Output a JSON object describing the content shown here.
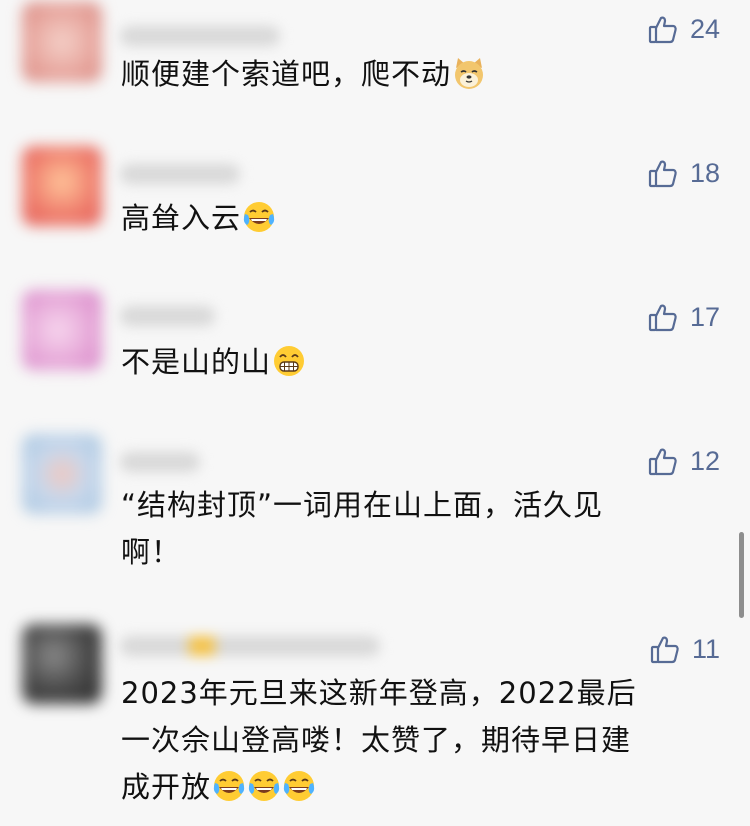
{
  "comments": [
    {
      "text": "顺便建个索道吧，爬不动",
      "likes": "24",
      "emoji": "doge-icon",
      "avatar_color": "#e8a8a0"
    },
    {
      "text": "高耸入云",
      "likes": "18",
      "emoji": "laugh-cry-icon",
      "avatar_color": "#ef7f6e"
    },
    {
      "text": "不是山的山",
      "likes": "17",
      "emoji": "grin-icon",
      "avatar_color": "#e6a8d8"
    },
    {
      "text": "“结构封顶”一词用在山上面，活久见\n啊！",
      "likes": "12",
      "avatar_color": "#a8c6e0"
    },
    {
      "text": "2023年元旦来这新年登高，2022最后\n一次佘山登高喽！太赞了，期待早日建\n成开放",
      "likes": "11",
      "emoji": "laugh-cry-icon",
      "emoji_count": 3,
      "avatar_color": "#4a4a4a"
    }
  ],
  "colors": {
    "like_accent": "#576b95",
    "background": "#f7f7f7",
    "text": "#111111"
  }
}
